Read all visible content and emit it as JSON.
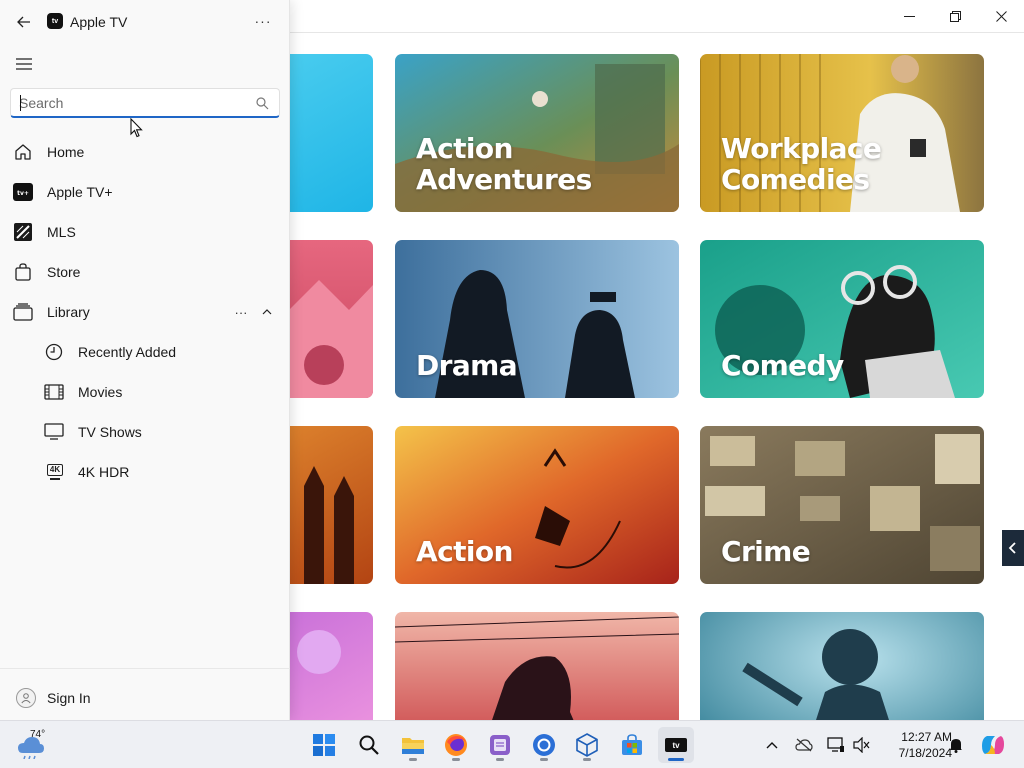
{
  "window": {
    "minimize": "Minimize",
    "maximize": "Maximize",
    "close": "Close"
  },
  "app": {
    "title": "Apple TV",
    "logo_text": "tv"
  },
  "search": {
    "placeholder": "Search",
    "value": ""
  },
  "nav": {
    "home": "Home",
    "apple_tv_plus": "Apple TV+",
    "mls": "MLS",
    "store": "Store",
    "library": "Library",
    "recently_added": "Recently Added",
    "movies": "Movies",
    "tv_shows": "TV Shows",
    "hdr": "4K HDR",
    "hdr_badge": "4K"
  },
  "footer": {
    "sign_in": "Sign In"
  },
  "tiles": {
    "r1c2": "Action\nAdventures",
    "r1c3": "Workplace\nComedies",
    "r2c2": "Drama",
    "r2c3": "Comedy",
    "r3c2": "Action",
    "r3c3": "Crime"
  },
  "taskbar": {
    "weather_temp": "74°",
    "time": "12:27 AM",
    "date": "7/18/2024",
    "active_app_label": "tv"
  },
  "colors": {
    "accent": "#1f66c6",
    "drawer_bg": "#f9f9f9",
    "taskbar_bg": "#eef0f4"
  },
  "icons": [
    "back-arrow-icon",
    "more-icon",
    "hamburger-icon",
    "search-icon",
    "home-icon",
    "apple-tv-plus-icon",
    "mls-icon",
    "store-icon",
    "library-icon",
    "clock-icon",
    "film-icon",
    "tv-icon",
    "4k-hdr-icon",
    "chevron-up-icon",
    "avatar-icon",
    "chevron-left-icon",
    "windows-start-icon",
    "taskbar-search-icon",
    "file-explorer-icon",
    "firefox-icon",
    "notepad-icon",
    "chrome-icon",
    "cube-icon",
    "microsoft-store-icon",
    "apple-tv-taskbar-icon",
    "chevron-up-tray-icon",
    "cloud-offline-icon",
    "display-icon",
    "speaker-muted-icon",
    "bell-icon",
    "copilot-icon"
  ]
}
